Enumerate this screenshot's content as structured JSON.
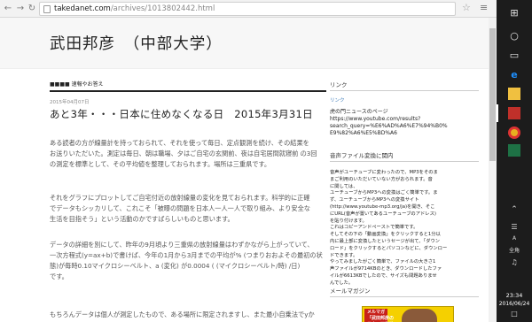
{
  "browser": {
    "url_host": "takedanet.com",
    "url_path": "/archives/1013802442.html"
  },
  "blog": {
    "title": "武田邦彦　（中部大学）"
  },
  "post": {
    "label": "■■■■ 速報やお答え",
    "date": "2015年04月07日",
    "title": "あと3年・・・日本に住めなくなる日　2015年3月31日",
    "p1": "ある読者の方が線量計を持っておられて、それを使って毎日、定点観測を続け、その結果を\nお送りいただいた。測定は毎日、朝は職場、夕はご自宅の玄関前、夜は自宅居間就寝前 の3回\nの測定を標準として、その平均値を整理しておられます。場所は三重県です。",
    "p2": "それをグラフにプロットしてご自宅付近の放射線量の変化を見ておられます。科学的に正確\nでデータもシッカリして、これこそ「被曝の問題を日本人一人一人で取り組み、より安全な\n生活を目指そう」という活動のかですばらしいものと思います。",
    "p3": "データの詳細を別にして、昨年の9月頃より三重県の放射線量はわずかながら上がっていて、\n一次方程式(y=ax+b)で書けば、今年の1月から3月までの平均が% (つまりおおよその最初の状\n態)が毎時0.10マイクロシーベルト、a (変化) が0.0004 ( (マイクロシーベルト/時) /日)\nです。",
    "p4": "もちろんデータは個人が測定したもので、ある場所に限定されますし、また最小自乗法でyか"
  },
  "sidebar": {
    "links_head": "リンク",
    "links_sub": "リンク",
    "links_item": "虎の門ニュースのページ\nhttps://www.youtube.com/results?\nsearch_query=%E6%AD%A6%E7%94%B0%\nE9%82%A6%E5%BD%A6",
    "audio_head": "音声ファイル変換に関内",
    "audio_text": "音声がユーチューブに変わったので、MP3をそのま\nまご利用のいただいていない方がおられます。音\nに関しては、\nユーチューブからMP3への変換はごく簡単です。ま\nず、ユーチューブからMP3への変換サイト\n(http://www.youtube-mp3.org/ja)を開き、そこ\nにURL(音声が置いてあるユーチューブのアドレス)\nを貼り付けます。\nこれはコピーアンドペーストで簡単です。\nそしてその下の「動画変換」をクリックすると1分以\n内に最上部に変換したというセージが出て、「ダウン\nロード」をクリックするとパソコンなどに、ダウンロー\nドできます。\nやってみましたがごく簡単で、ファイルの大きさ1\n声ファイルが9714KBのとき、ダウンロードしたファ\nイルが6613KBでしたので、サイズも問題ありませ\nんでした。",
    "mag_head": "メールマガジン",
    "mag_banner": "メルマガ\n「武田邦彦の\n日本の可能性"
  },
  "taskbar": {
    "ime": "A",
    "ime2": "全角",
    "time": "23:34",
    "date": "2016/06/24"
  }
}
